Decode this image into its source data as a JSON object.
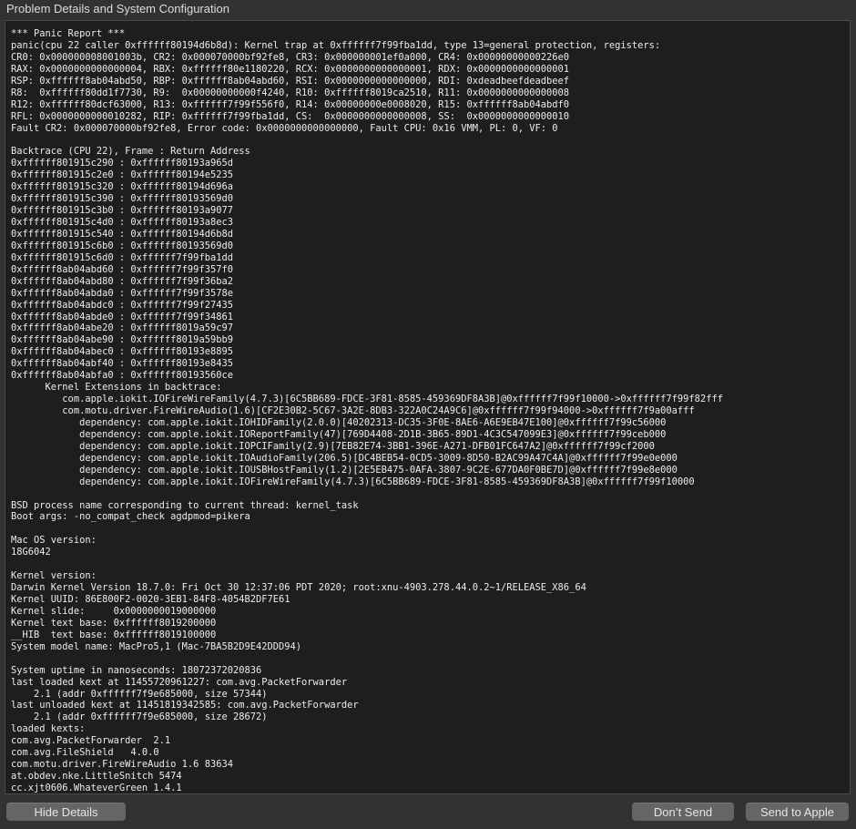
{
  "window": {
    "title": "Problem Details and System Configuration"
  },
  "report_lines": [
    "*** Panic Report ***",
    "panic(cpu 22 caller 0xffffff80194d6b8d): Kernel trap at 0xffffff7f99fba1dd, type 13=general protection, registers:",
    "CR0: 0x000000008001003b, CR2: 0x000070000bf92fe8, CR3: 0x000000001ef0a000, CR4: 0x00000000000226e0",
    "RAX: 0x0000000000000004, RBX: 0xffffff80e1180220, RCX: 0x0000000000000001, RDX: 0x0000000000000001",
    "RSP: 0xffffff8ab04abd50, RBP: 0xffffff8ab04abd60, RSI: 0x0000000000000000, RDI: 0xdeadbeefdeadbeef",
    "R8:  0xffffff80dd1f7730, R9:  0x00000000000f4240, R10: 0xffffff8019ca2510, R11: 0x0000000000000008",
    "R12: 0xffffff80dcf63000, R13: 0xffffff7f99f556f0, R14: 0x00000000e0008020, R15: 0xffffff8ab04abdf0",
    "RFL: 0x0000000000010282, RIP: 0xffffff7f99fba1dd, CS:  0x0000000000000008, SS:  0x0000000000000010",
    "Fault CR2: 0x000070000bf92fe8, Error code: 0x0000000000000000, Fault CPU: 0x16 VMM, PL: 0, VF: 0",
    "",
    "Backtrace (CPU 22), Frame : Return Address",
    "0xffffff801915c290 : 0xffffff80193a965d",
    "0xffffff801915c2e0 : 0xffffff80194e5235",
    "0xffffff801915c320 : 0xffffff80194d696a",
    "0xffffff801915c390 : 0xffffff80193569d0",
    "0xffffff801915c3b0 : 0xffffff80193a9077",
    "0xffffff801915c4d0 : 0xffffff80193a8ec3",
    "0xffffff801915c540 : 0xffffff80194d6b8d",
    "0xffffff801915c6b0 : 0xffffff80193569d0",
    "0xffffff801915c6d0 : 0xffffff7f99fba1dd",
    "0xffffff8ab04abd60 : 0xffffff7f99f357f0",
    "0xffffff8ab04abd80 : 0xffffff7f99f36ba2",
    "0xffffff8ab04abda0 : 0xffffff7f99f3578e",
    "0xffffff8ab04abdc0 : 0xffffff7f99f27435",
    "0xffffff8ab04abde0 : 0xffffff7f99f34861",
    "0xffffff8ab04abe20 : 0xffffff8019a59c97",
    "0xffffff8ab04abe90 : 0xffffff8019a59bb9",
    "0xffffff8ab04abec0 : 0xffffff80193e8895",
    "0xffffff8ab04abf40 : 0xffffff80193e8435",
    "0xffffff8ab04abfa0 : 0xffffff80193560ce",
    "      Kernel Extensions in backtrace:",
    "         com.apple.iokit.IOFireWireFamily(4.7.3)[6C5BB689-FDCE-3F81-8585-459369DF8A3B]@0xffffff7f99f10000->0xffffff7f99f82fff",
    "         com.motu.driver.FireWireAudio(1.6)[CF2E30B2-5C67-3A2E-8DB3-322A0C24A9C6]@0xffffff7f99f94000->0xffffff7f9a00afff",
    "            dependency: com.apple.iokit.IOHIDFamily(2.0.0)[40202313-DC35-3F0E-8AE6-A6E9EB47E100]@0xffffff7f99c56000",
    "            dependency: com.apple.iokit.IOReportFamily(47)[769D4408-2D1B-3B65-89D1-4C3C547099E3]@0xffffff7f99ceb000",
    "            dependency: com.apple.iokit.IOPCIFamily(2.9)[7EB82E74-3BB1-396E-A271-DFB01FC647A2]@0xffffff7f99cf2000",
    "            dependency: com.apple.iokit.IOAudioFamily(206.5)[DC4BEB54-0CD5-3009-8D50-B2AC99A47C4A]@0xffffff7f99e0e000",
    "            dependency: com.apple.iokit.IOUSBHostFamily(1.2)[2E5EB475-0AFA-3807-9C2E-677DA0F0BE7D]@0xffffff7f99e8e000",
    "            dependency: com.apple.iokit.IOFireWireFamily(4.7.3)[6C5BB689-FDCE-3F81-8585-459369DF8A3B]@0xffffff7f99f10000",
    "",
    "BSD process name corresponding to current thread: kernel_task",
    "Boot args: -no_compat_check agdpmod=pikera",
    "",
    "Mac OS version:",
    "18G6042",
    "",
    "Kernel version:",
    "Darwin Kernel Version 18.7.0: Fri Oct 30 12:37:06 PDT 2020; root:xnu-4903.278.44.0.2~1/RELEASE_X86_64",
    "Kernel UUID: 86E800F2-0020-3EB1-84F8-4054B2DF7E61",
    "Kernel slide:     0x0000000019000000",
    "Kernel text base: 0xffffff8019200000",
    "__HIB  text base: 0xffffff8019100000",
    "System model name: MacPro5,1 (Mac-7BA5B2D9E42DDD94)",
    "",
    "System uptime in nanoseconds: 18072372020836",
    "last loaded kext at 11455720961227: com.avg.PacketForwarder",
    "    2.1 (addr 0xffffff7f9e685000, size 57344)",
    "last unloaded kext at 11451819342585: com.avg.PacketForwarder",
    "    2.1 (addr 0xffffff7f9e685000, size 28672)",
    "loaded kexts:",
    "com.avg.PacketForwarder  2.1",
    "com.avg.FileShield   4.0.0",
    "com.motu.driver.FireWireAudio 1.6 83634",
    "at.obdev.nke.LittleSnitch 5474",
    "cc.xjt0606.WhateverGreen 1.4.1"
  ],
  "buttons": {
    "hide_details": "Hide Details",
    "dont_send": "Don’t Send",
    "send_to_apple": "Send to Apple"
  }
}
